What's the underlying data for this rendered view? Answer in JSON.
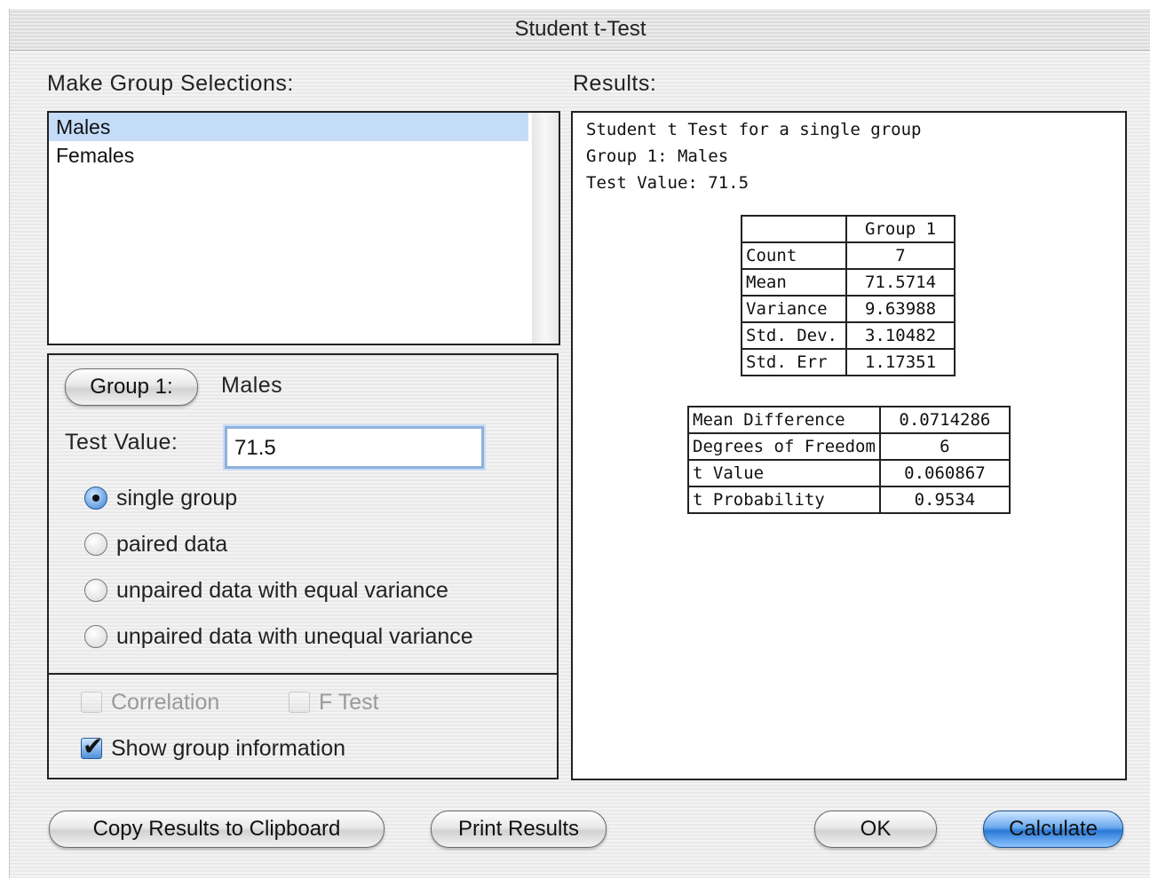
{
  "window": {
    "title": "Student t-Test"
  },
  "selection": {
    "heading": "Make Group Selections:",
    "groups": [
      "Males",
      "Females"
    ],
    "selected_index": 0
  },
  "group_controls": {
    "group1_button": "Group 1:",
    "group1_value": "Males",
    "test_value_label": "Test Value:",
    "test_value": "71.5"
  },
  "radio_options": [
    {
      "label": "single group",
      "selected": true
    },
    {
      "label": "paired data",
      "selected": false
    },
    {
      "label": "unpaired data with equal variance",
      "selected": false
    },
    {
      "label": "unpaired data with unequal variance",
      "selected": false
    }
  ],
  "checkboxes": {
    "correlation": {
      "label": "Correlation",
      "checked": false,
      "enabled": false
    },
    "f_test": {
      "label": "F Test",
      "checked": false,
      "enabled": false
    },
    "show_group_info": {
      "label": "Show group information",
      "checked": true,
      "enabled": true
    }
  },
  "results": {
    "heading": "Results:",
    "lines": [
      "Student t Test for a single group",
      "Group 1:  Males",
      "Test Value:  71.5"
    ],
    "group_table": {
      "header": "Group 1",
      "rows": [
        {
          "label": "Count",
          "value": "7"
        },
        {
          "label": "Mean",
          "value": "71.5714"
        },
        {
          "label": "Variance",
          "value": "9.63988"
        },
        {
          "label": "Std. Dev.",
          "value": "3.10482"
        },
        {
          "label": "Std. Err",
          "value": "1.17351"
        }
      ]
    },
    "test_table": {
      "rows": [
        {
          "label": "Mean Difference",
          "value": "0.0714286"
        },
        {
          "label": "Degrees of Freedom",
          "value": "6"
        },
        {
          "label": "t Value",
          "value": "0.060867"
        },
        {
          "label": "t Probability",
          "value": "0.9534"
        }
      ]
    }
  },
  "buttons": {
    "copy": "Copy Results to Clipboard",
    "print": "Print Results",
    "ok": "OK",
    "calculate": "Calculate"
  },
  "colors": {
    "selection": "#c5dcf9",
    "default_button": "#2a79d6",
    "focus_ring": "#8fb1dc"
  }
}
